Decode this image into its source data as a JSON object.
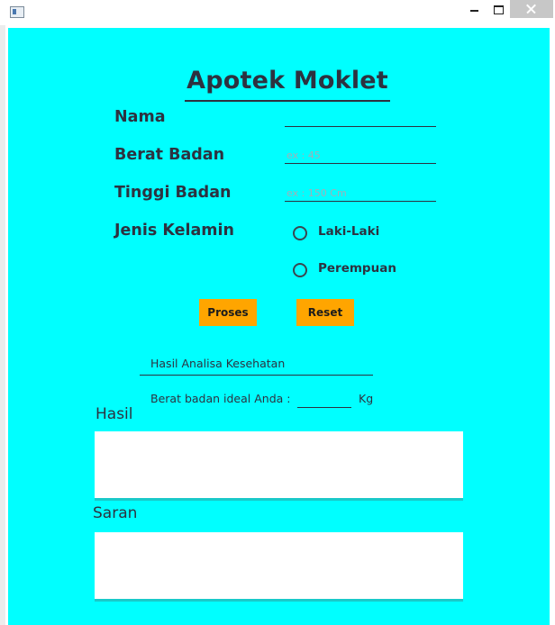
{
  "window": {
    "app_icon": "window-icon",
    "controls": {
      "minimize": "minimize-icon",
      "maximize": "maximize-icon",
      "close": "close-icon"
    }
  },
  "form": {
    "title": "Apotek Moklet",
    "fields": {
      "nama": {
        "label": "Nama",
        "value": "",
        "placeholder": ""
      },
      "berat_badan": {
        "label": "Berat Badan",
        "value": "",
        "placeholder": "ex : 45"
      },
      "tinggi_badan": {
        "label": "Tinggi Badan",
        "value": "",
        "placeholder": "ex : 150 Cm"
      }
    },
    "jenis_kelamin": {
      "label": "Jenis Kelamin",
      "options": [
        {
          "label": "Laki-Laki",
          "selected": false
        },
        {
          "label": "Perempuan",
          "selected": false
        }
      ]
    },
    "buttons": {
      "proses": "Proses",
      "reset": "Reset"
    },
    "colors": {
      "background": "#00ffff",
      "button": "#ffa500",
      "text": "#2d3240"
    }
  },
  "result": {
    "header": "Hasil Analisa Kesehatan",
    "ideal_label": "Berat badan ideal Anda :",
    "ideal_value": "",
    "ideal_unit": "Kg",
    "hasil_label": "Hasil",
    "hasil_value": "",
    "saran_label": "Saran",
    "saran_value": ""
  }
}
